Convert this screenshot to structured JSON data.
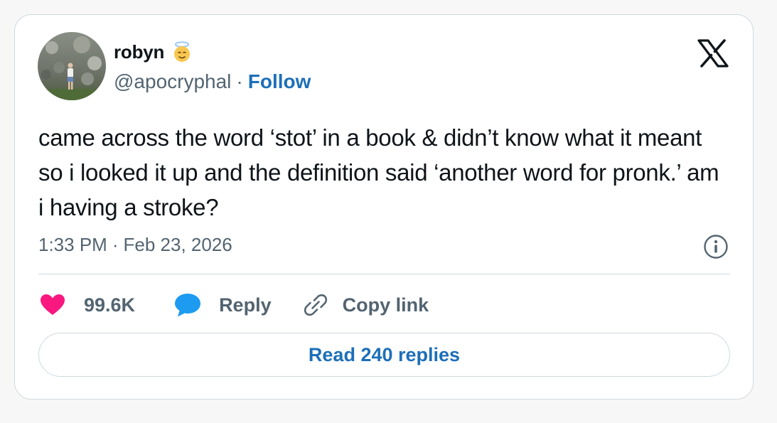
{
  "tweet": {
    "author": {
      "name": "robyn",
      "emoji_icon": "smiling-face-with-halo-icon",
      "handle": "@apocryphal",
      "separator": "·",
      "follow_label": "Follow"
    },
    "brand_icon": "x-logo-icon",
    "text": "came across the word ‘stot’ in a book & didn’t know what it meant so i looked it up and the definition said ‘another word for pronk.’ am i having a stroke?",
    "timestamp": {
      "time": "1:33 PM",
      "separator": "·",
      "date": "Feb 23, 2026"
    },
    "info_icon": "info-icon",
    "actions": {
      "like_count": "99.6K",
      "reply_label": "Reply",
      "copy_label": "Copy link"
    },
    "read_replies_label": "Read 240 replies"
  },
  "colors": {
    "text": "#0f1419",
    "muted": "#536471",
    "link": "#1d6fb8",
    "heart": "#f91880",
    "reply_bubble": "#1d9bf0",
    "border": "#cfd9de"
  }
}
